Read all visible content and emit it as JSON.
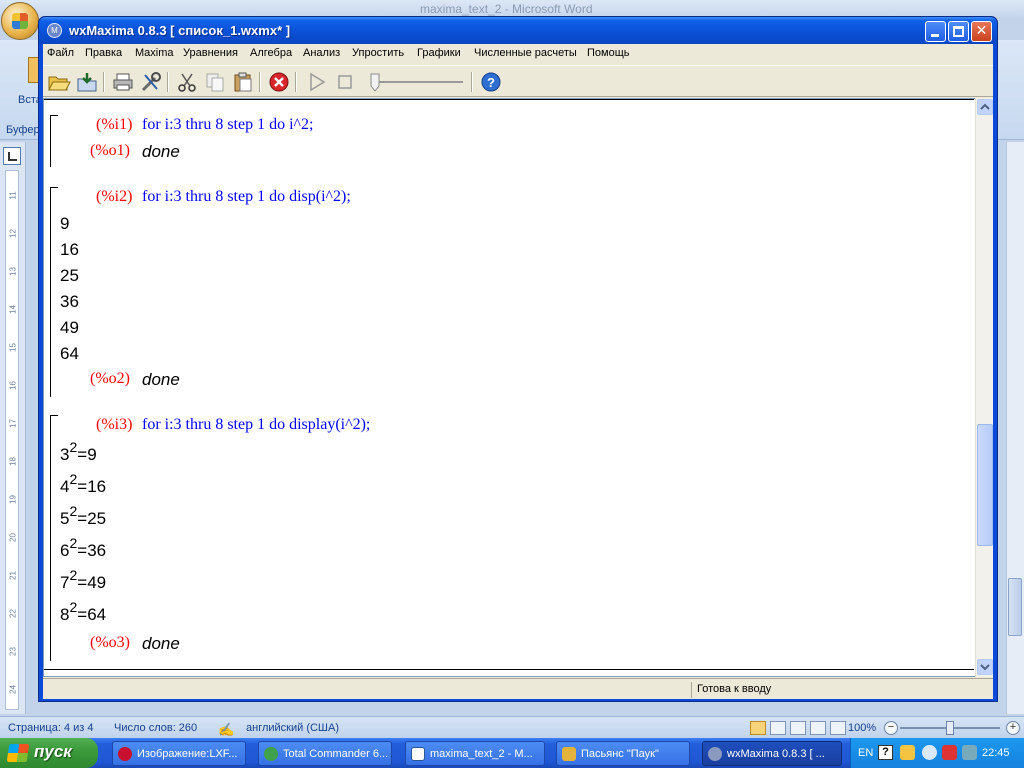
{
  "word": {
    "title": "maxima_text_2 - Microsoft Word",
    "ribbon_paste_label": "Вста",
    "ribbon_group_label": "Буфер",
    "status": {
      "page": "Страница: 4 из 4",
      "words": "Число слов: 260",
      "language": "английский (США)",
      "zoom": "100%"
    },
    "ruler_numbers": [
      "11",
      "12",
      "13",
      "14",
      "15",
      "16",
      "17",
      "18",
      "19",
      "20",
      "21",
      "22",
      "23",
      "24"
    ]
  },
  "wxmaxima": {
    "title": "wxMaxima 0.8.3 [ список_1.wxmx* ]",
    "menu": [
      "Файл",
      "Правка",
      "Maxima",
      "Уравнения",
      "Алгебра",
      "Анализ",
      "Упростить",
      "Графики",
      "Численные расчеты",
      "Помощь"
    ],
    "status": "Готова к вводу",
    "cells": [
      {
        "in_label": "(%i1)",
        "input": "for i:3 thru 8 step 1 do i^2;",
        "out_label": "(%o1)",
        "result": "done",
        "lines": []
      },
      {
        "in_label": "(%i2)",
        "input": "for i:3 thru 8 step 1 do disp(i^2);",
        "out_label": "(%o2)",
        "result": "done",
        "lines": [
          "9",
          "16",
          "25",
          "36",
          "49",
          "64"
        ]
      },
      {
        "in_label": "(%i3)",
        "input": "for i:3 thru 8 step 1 do display(i^2);",
        "out_label": "(%o3)",
        "result": "done",
        "powers": [
          {
            "base": "3",
            "exp": "2",
            "value": "=9"
          },
          {
            "base": "4",
            "exp": "2",
            "value": "=16"
          },
          {
            "base": "5",
            "exp": "2",
            "value": "=25"
          },
          {
            "base": "6",
            "exp": "2",
            "value": "=36"
          },
          {
            "base": "7",
            "exp": "2",
            "value": "=49"
          },
          {
            "base": "8",
            "exp": "2",
            "value": "=64"
          }
        ]
      }
    ]
  },
  "taskbar": {
    "start": "пуск",
    "tasks": [
      "Изображение:LXF...",
      "Total Commander 6...",
      "maxima_text_2 - M...",
      "Пасьянс \"Паук\"",
      "wxMaxima 0.8.3 [ ..."
    ],
    "lang": "EN",
    "clock": "22:45"
  },
  "colors": {
    "input_code": "#0000ff",
    "labels": "#ff0000",
    "title_blue": "#0b4ad9"
  }
}
